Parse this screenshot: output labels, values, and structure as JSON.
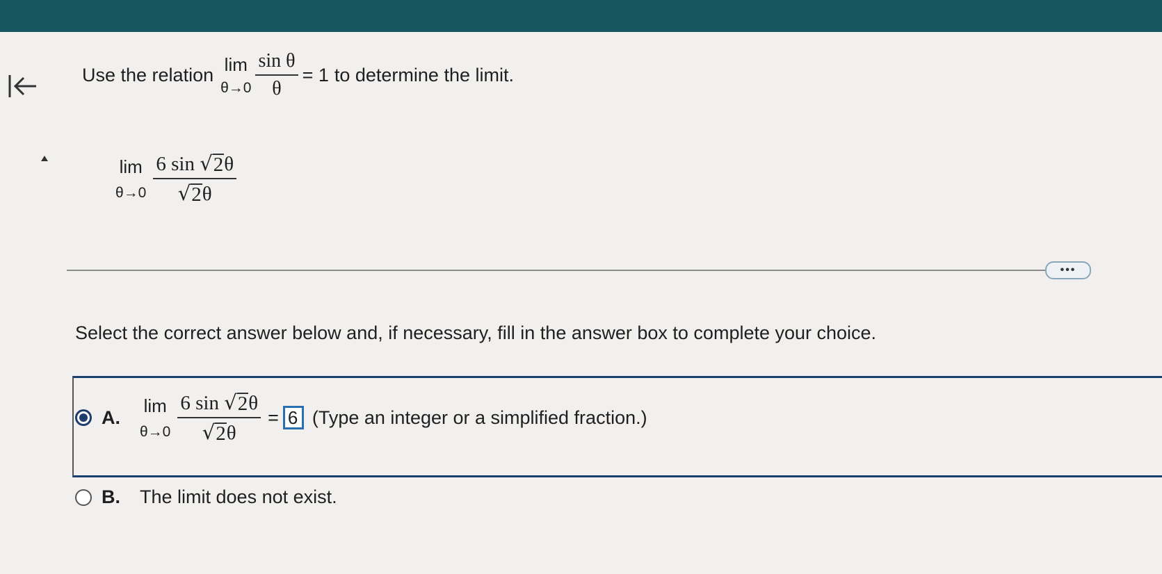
{
  "nav": {
    "back_icon": "back-to-start-arrow-icon",
    "more_label": "•••"
  },
  "question": {
    "prefix": "Use the relation",
    "relation": {
      "lim": "lim",
      "sub": "θ→0",
      "numerator": "sin θ",
      "denominator": "θ",
      "equals": "= 1"
    },
    "suffix": "to determine the limit.",
    "expression": {
      "lim": "lim",
      "sub": "θ→0",
      "num_coef": "6 sin",
      "radical_sign": "√",
      "radicand": "2",
      "num_var": "θ",
      "den_radical_sign": "√",
      "den_radicand": "2",
      "den_var": "θ"
    }
  },
  "instruction": "Select the correct answer below and, if necessary, fill in the answer box to complete your choice.",
  "choices": {
    "a": {
      "letter": "A.",
      "selected": true,
      "lim": "lim",
      "sub": "θ→0",
      "num_coef": "6 sin",
      "radical_sign": "√",
      "radicand": "2",
      "num_var": "θ",
      "den_radical_sign": "√",
      "den_radicand": "2",
      "den_var": "θ",
      "equals": "=",
      "answer_value": "6",
      "hint": "(Type an integer or a simplified fraction.)"
    },
    "b": {
      "letter": "B.",
      "selected": false,
      "text": "The limit does not exist."
    }
  },
  "colors": {
    "header_bar": "#17555f",
    "selected_radio": "#1f3e6d",
    "input_border": "#2a6fb0"
  }
}
